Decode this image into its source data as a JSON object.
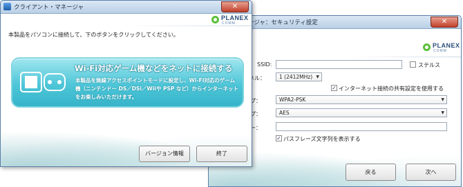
{
  "security_window": {
    "title": "マネージャ：セキュリティ設定",
    "logo_brand": "PLANEX",
    "logo_sub": "COMM",
    "ssid_label": "SSID:",
    "stealth_label": "ステルス",
    "channel_label": "ャネル：",
    "channel_value": "1 (2412MHz)",
    "internet_share_label": "インターネット接続の共有設定を使用する",
    "auth_type_label": "タイプ：",
    "auth_type_value": "WPA2-PSK",
    "encrypt_type_label": "タイプ：",
    "encrypt_type_value": "AES",
    "key_label": "ドキー：",
    "show_passphrase_label": "パスフレーズ文字列を表示する",
    "back_label": "戻る",
    "next_label": "次へ",
    "close_glyph": "✕"
  },
  "client_window": {
    "title": "クライアント・マネージャ",
    "logo_brand": "PLANEX",
    "logo_sub": "COMM",
    "instruction": "本製品をパソコンに接続して、下のボタンをクリックしてください。",
    "banner_title": "Wi-Fi対応ゲーム機などをネットに接続する",
    "banner_desc_1": "本製品を無線アクセスポイントモードに設定し、Wi-Fi対応のゲーム",
    "banner_desc_2": "機（ニンテンドー DS／DSi／Wiiや PSP など）からインターネット",
    "banner_desc_3": "をお楽しみいただけます。",
    "version_label": "バージョン情報",
    "exit_label": "終了",
    "close_glyph": "✕"
  }
}
